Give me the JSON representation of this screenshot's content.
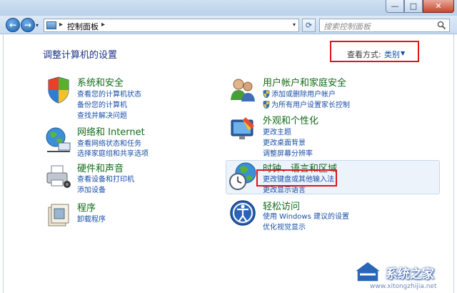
{
  "window": {
    "min_glyph": "—",
    "max_glyph": "□",
    "close_glyph": "✕"
  },
  "nav": {
    "back_glyph": "←",
    "forward_glyph": "→",
    "dropdown_glyph": "▾",
    "address_separator": "▸",
    "address_text": "控制面板",
    "refresh_glyph": "⟳",
    "search_placeholder": "搜索控制面板"
  },
  "page": {
    "title": "调整计算机的设置",
    "view_by_label": "查看方式:",
    "view_by_value": "类别",
    "view_by_arrow": "▼"
  },
  "categories": [
    {
      "icon": "shield-flag-icon",
      "title": "系统和安全",
      "links": [
        "查看您的计算机状态",
        "备份您的计算机",
        "查找并解决问题"
      ]
    },
    {
      "icon": "network-globe-icon",
      "title": "网络和 Internet",
      "links": [
        "查看网络状态和任务",
        "选择家庭组和共享选项"
      ]
    },
    {
      "icon": "printer-icon",
      "title": "硬件和声音",
      "links": [
        "查看设备和打印机",
        "添加设备"
      ]
    },
    {
      "icon": "programs-icon",
      "title": "程序",
      "links": [
        "卸载程序"
      ]
    },
    {
      "icon": "users-icon",
      "title": "用户帐户和家庭安全",
      "links": [
        "添加或删除用户帐户",
        "为所有用户设置家长控制"
      ]
    },
    {
      "icon": "monitor-paint-icon",
      "title": "外观和个性化",
      "links": [
        "更改主题",
        "更改桌面背景",
        "调整屏幕分辨率"
      ]
    },
    {
      "icon": "clock-globe-icon",
      "title": "时钟、语言和区域",
      "links": [
        "更改键盘或其他输入法",
        "更改显示语言"
      ]
    },
    {
      "icon": "ease-of-access-icon",
      "title": "轻松访问",
      "links": [
        "使用 Windows 建议的设置",
        "优化视觉显示"
      ]
    }
  ],
  "watermark": {
    "text": "系统之家",
    "url": "www.xitongzhijia.net"
  }
}
